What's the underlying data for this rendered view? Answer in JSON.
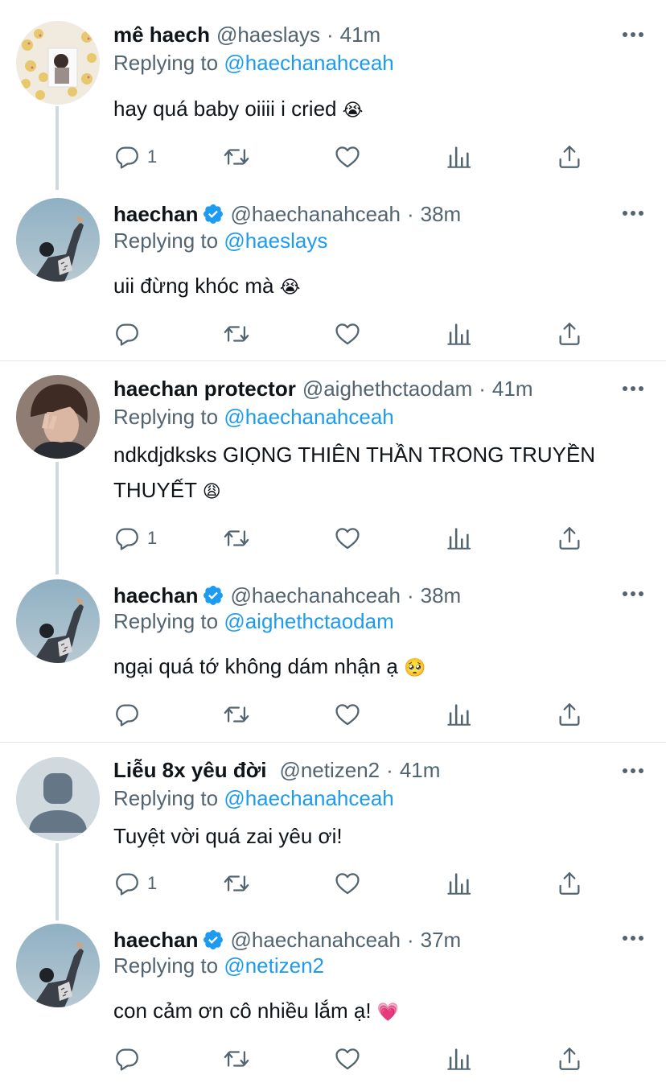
{
  "tweets": [
    {
      "name": "mê haech",
      "handle": "@haeslays",
      "dot": "·",
      "time": "41m",
      "reply_prefix": "Replying to",
      "reply_to": "@haechanahceah",
      "text": "hay quá baby oiiii i cried",
      "emoji": "😭",
      "reply_count": "1",
      "verified": false
    },
    {
      "name": "haechan",
      "handle": "@haechanahceah",
      "dot": "·",
      "time": "38m",
      "reply_prefix": "Replying to",
      "reply_to": "@haeslays",
      "text": "uii đừng khóc mà",
      "emoji": "😭",
      "reply_count": "",
      "verified": true
    },
    {
      "name": "haechan protector",
      "handle": "@aighethctaodam",
      "dot": "·",
      "time": "41m",
      "reply_prefix": "Replying to",
      "reply_to": "@haechanahceah",
      "text": "ndkdjdksks GIỌNG THIÊN THẦN TRONG TRUYỀN THUYẾT",
      "emoji": "😩",
      "reply_count": "1",
      "verified": false
    },
    {
      "name": "haechan",
      "handle": "@haechanahceah",
      "dot": "·",
      "time": "38m",
      "reply_prefix": "Replying to",
      "reply_to": "@aighethctaodam",
      "text": "ngại quá tớ không dám nhận ạ",
      "emoji": "🥺",
      "reply_count": "",
      "verified": true
    },
    {
      "name": "Liễu 8x yêu đời",
      "handle": "@netizen2",
      "dot": "·",
      "time": "41m",
      "reply_prefix": "Replying to",
      "reply_to": "@haechanahceah",
      "text": "Tuyệt vời quá zai yêu ơi!",
      "emoji": "",
      "reply_count": "1",
      "verified": false
    },
    {
      "name": "haechan",
      "handle": "@haechanahceah",
      "dot": "·",
      "time": "37m",
      "reply_prefix": "Replying to",
      "reply_to": "@netizen2",
      "text": "con cảm ơn cô nhiều lắm ạ!",
      "emoji": "💗",
      "reply_count": "",
      "verified": true
    }
  ],
  "colors": {
    "link": "#1d9bf0",
    "secondary": "#536471",
    "verified": "#1d9bf0",
    "thread_line": "#cfd9de",
    "divider": "#e3e6e8"
  },
  "icons": [
    "reply-icon",
    "retweet-icon",
    "like-icon",
    "analytics-icon",
    "share-icon",
    "more-icon",
    "verified-badge-icon"
  ]
}
